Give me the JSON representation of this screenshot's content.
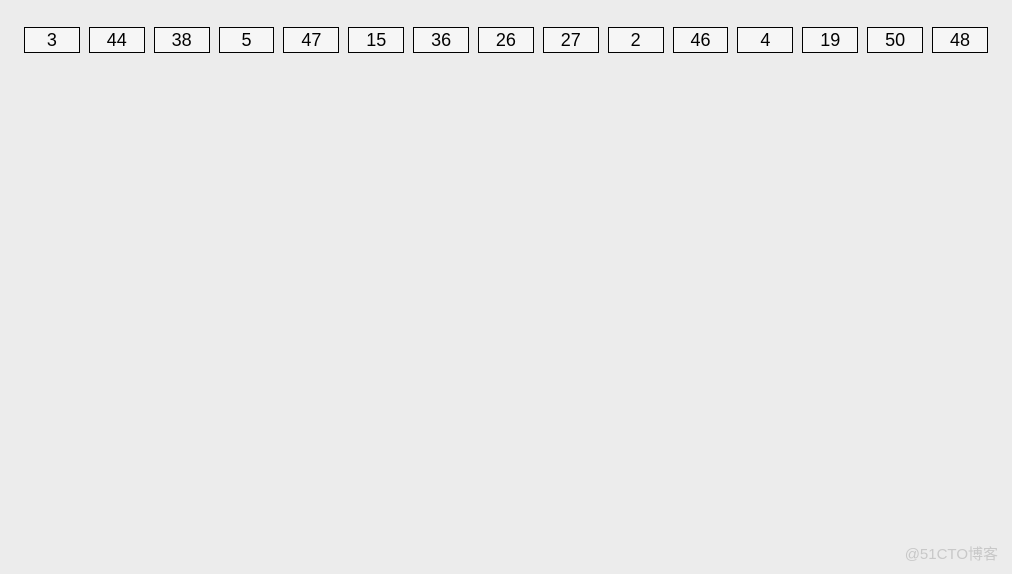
{
  "cells": [
    3,
    44,
    38,
    5,
    47,
    15,
    36,
    26,
    27,
    2,
    46,
    4,
    19,
    50,
    48
  ],
  "watermark": "@51CTO博客"
}
